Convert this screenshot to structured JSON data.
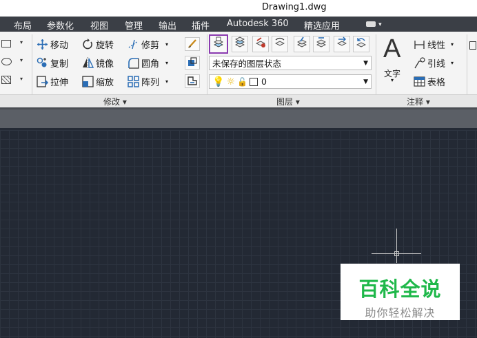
{
  "window": {
    "title": "Drawing1.dwg"
  },
  "menu_tabs": [
    "布局",
    "参数化",
    "视图",
    "管理",
    "输出",
    "插件",
    "Autodesk 360",
    "精选应用"
  ],
  "modify_panel": {
    "title": "修改 ▾",
    "tools": {
      "move": "移动",
      "rotate": "旋转",
      "trim": "修剪",
      "copy": "复制",
      "mirror": "镜像",
      "fillet": "圆角",
      "stretch": "拉伸",
      "scale": "缩放",
      "array": "阵列"
    }
  },
  "layers_panel": {
    "title": "图层 ▾",
    "layer_state": "未保存的图层状态",
    "current_layer": "0"
  },
  "annotation_panel": {
    "title": "注释 ▾",
    "text_label": "文字",
    "linear": "线性",
    "leader": "引线",
    "table": "表格"
  },
  "watermark": {
    "main": "百科全说",
    "sub": "助你轻松解决"
  },
  "colors": {
    "highlight": "#8a3ab0",
    "watermark_green": "#1fb84a"
  }
}
